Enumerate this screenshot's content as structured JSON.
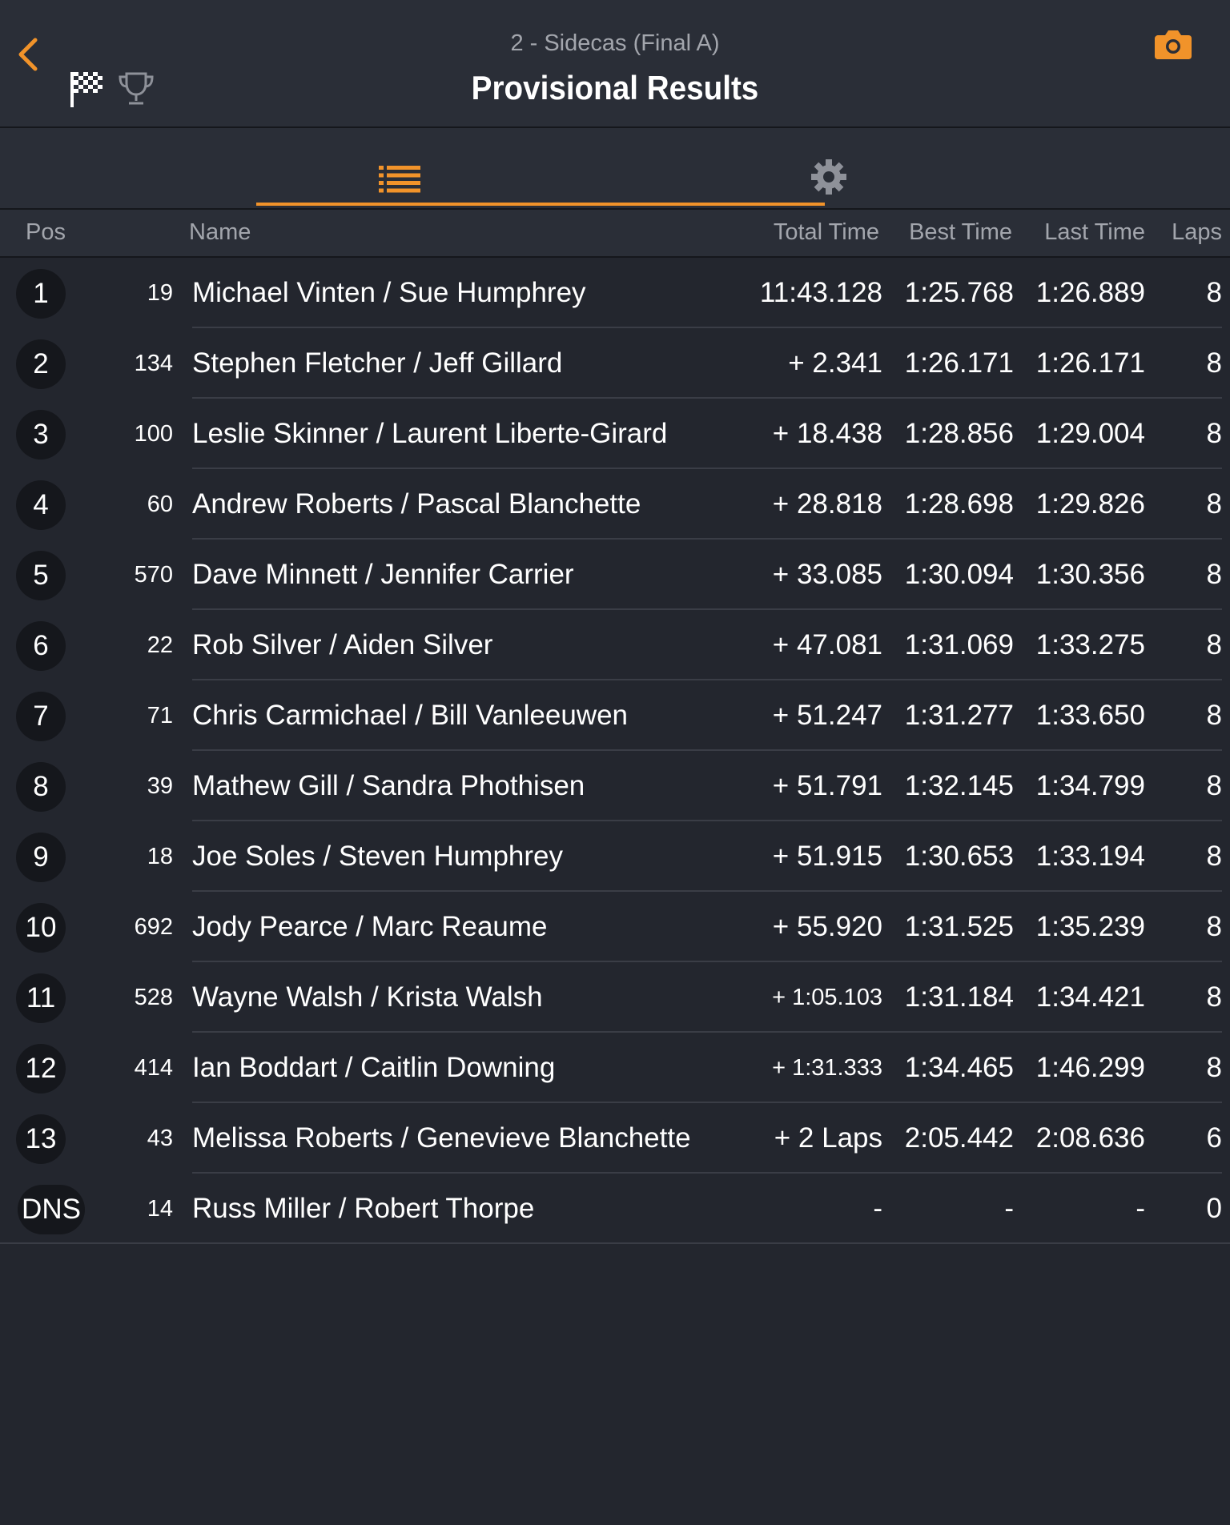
{
  "header": {
    "subtitle": "2 - Sidecas (Final A)",
    "title": "Provisional Results",
    "icons": [
      "chevron-left-icon",
      "checkered-flag-icon",
      "trophy-icon",
      "camera-icon"
    ]
  },
  "tabs": [
    {
      "icon": "list-icon",
      "selected": true
    },
    {
      "icon": "gear-icon",
      "selected": false
    }
  ],
  "colors": {
    "accent": "#f1932a",
    "background": "#23262e",
    "header": "#2a2e37"
  },
  "columns": {
    "pos": "Pos",
    "name": "Name",
    "total": "Total Time",
    "best": "Best Time",
    "last": "Last Time",
    "laps": "Laps"
  },
  "rows": [
    {
      "pos": "1",
      "num": "19",
      "name": "Michael Vinten /  Sue Humphrey",
      "total": "11:43.128",
      "best": "1:25.768",
      "last": "1:26.889",
      "laps": "8"
    },
    {
      "pos": "2",
      "num": "134",
      "name": "Stephen Fletcher /  Jeff Gillard",
      "total": "+ 2.341",
      "best": "1:26.171",
      "last": "1:26.171",
      "laps": "8"
    },
    {
      "pos": "3",
      "num": "100",
      "name": "Leslie Skinner /  Laurent Liberte-Girard",
      "total": "+ 18.438",
      "best": "1:28.856",
      "last": "1:29.004",
      "laps": "8"
    },
    {
      "pos": "4",
      "num": "60",
      "name": "Andrew Roberts /  Pascal Blanchette",
      "total": "+ 28.818",
      "best": "1:28.698",
      "last": "1:29.826",
      "laps": "8"
    },
    {
      "pos": "5",
      "num": "570",
      "name": "Dave Minnett /  Jennifer Carrier",
      "total": "+ 33.085",
      "best": "1:30.094",
      "last": "1:30.356",
      "laps": "8"
    },
    {
      "pos": "6",
      "num": "22",
      "name": "Rob Silver /  Aiden Silver",
      "total": "+ 47.081",
      "best": "1:31.069",
      "last": "1:33.275",
      "laps": "8"
    },
    {
      "pos": "7",
      "num": "71",
      "name": "Chris Carmichael /  Bill Vanleeuwen",
      "total": "+ 51.247",
      "best": "1:31.277",
      "last": "1:33.650",
      "laps": "8"
    },
    {
      "pos": "8",
      "num": "39",
      "name": "Mathew Gill /  Sandra Phothisen",
      "total": "+ 51.791",
      "best": "1:32.145",
      "last": "1:34.799",
      "laps": "8"
    },
    {
      "pos": "9",
      "num": "18",
      "name": "Joe Soles /  Steven Humphrey",
      "total": "+ 51.915",
      "best": "1:30.653",
      "last": "1:33.194",
      "laps": "8"
    },
    {
      "pos": "10",
      "num": "692",
      "name": "Jody Pearce /  Marc Reaume",
      "total": "+ 55.920",
      "best": "1:31.525",
      "last": "1:35.239",
      "laps": "8"
    },
    {
      "pos": "11",
      "num": "528",
      "name": "Wayne Walsh /  Krista Walsh",
      "total": "+ 1:05.103",
      "best": "1:31.184",
      "last": "1:34.421",
      "laps": "8"
    },
    {
      "pos": "12",
      "num": "414",
      "name": "Ian Boddart /  Caitlin Downing",
      "total": "+ 1:31.333",
      "best": "1:34.465",
      "last": "1:46.299",
      "laps": "8"
    },
    {
      "pos": "13",
      "num": "43",
      "name": "Melissa Roberts /  Genevieve Blanchette",
      "total": "+ 2 Laps",
      "best": "2:05.442",
      "last": "2:08.636",
      "laps": "6"
    },
    {
      "pos": "DNS",
      "num": "14",
      "name": "Russ Miller /  Robert Thorpe",
      "total": "-",
      "best": "-",
      "last": "-",
      "laps": "0"
    }
  ]
}
